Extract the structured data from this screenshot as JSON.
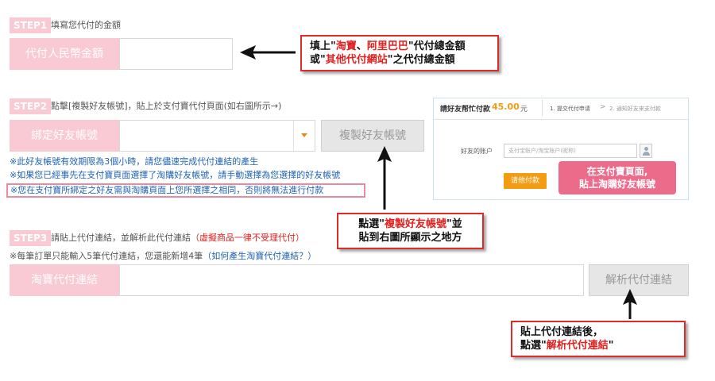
{
  "step1": {
    "badge": "STEP1",
    "text": "填寫您代付的金額",
    "label": "代付人民幣金額",
    "input_value": ""
  },
  "step2": {
    "badge": "STEP2",
    "text": "點擊[複製好友帳號]，貼上於支付寶代付頁面(如右圖所示→)",
    "label": "綁定好友帳號",
    "select_value": "",
    "copy_button": "複製好友帳號",
    "notes": [
      "※此好友帳號有效期限為3個小時，請您儘速完成代付連結的產生",
      "※如果您已經事先在支付寶頁面選擇了淘購好友帳號，請手動選擇為您選擇的好友帳號",
      "※您在支付寶所綁定之好友需與淘購頁面上您所選擇之相同，否則將無法進行付款"
    ]
  },
  "step3": {
    "badge": "STEP3",
    "text": "請貼上代付連結，並解析此代付連結",
    "warning": "（虛擬商品一律不受理代付）",
    "note_prefix": "※每筆訂單只能輸入5筆代付連結，您還能新增4筆",
    "note_link": "（如何產生淘寶代付連結？）",
    "label": "淘寶代付連結",
    "input_value": "",
    "parse_button": "解析代付連結"
  },
  "callout1": {
    "line1_a": "填上\"",
    "line1_hl1": "淘寶",
    "line1_b": "、",
    "line1_hl2": "阿里巴巴",
    "line1_c": "\"代付總金額",
    "line2_a": "或\"",
    "line2_hl": "其他代付網站",
    "line2_b": "\"之代付總金額"
  },
  "callout2": {
    "line1_a": "點選\"",
    "line1_hl": "複製好友帳號",
    "line1_b": "\"並",
    "line2": "貼到右圖所顯示之地方"
  },
  "callout3": {
    "line1": "貼上代付連結後，",
    "line2_a": "點選\"",
    "line2_hl": "解析代付連結",
    "line2_b": "\""
  },
  "alipay_panel": {
    "title": "請好友帮忙付款",
    "amount": "45.00",
    "unit": "元",
    "step_1": "1. 提交代付申请",
    "arrow": ">",
    "step_2": "2. 通知好友来支付款",
    "field_label": "好友的账户",
    "field_placeholder": "支付宝账户/淘宝账户(昵称)",
    "submit_button": "请他付款",
    "tag_line1": "在支付寶頁面,",
    "tag_line2": "貼上淘購好友帳號"
  },
  "colors": {
    "pink_badge": "#f9c9d4",
    "accent_pink": "#ec6b8a",
    "highlight_red": "#e0201e",
    "note_blue": "#1f63b3",
    "alipay_orange": "#f39c12"
  }
}
